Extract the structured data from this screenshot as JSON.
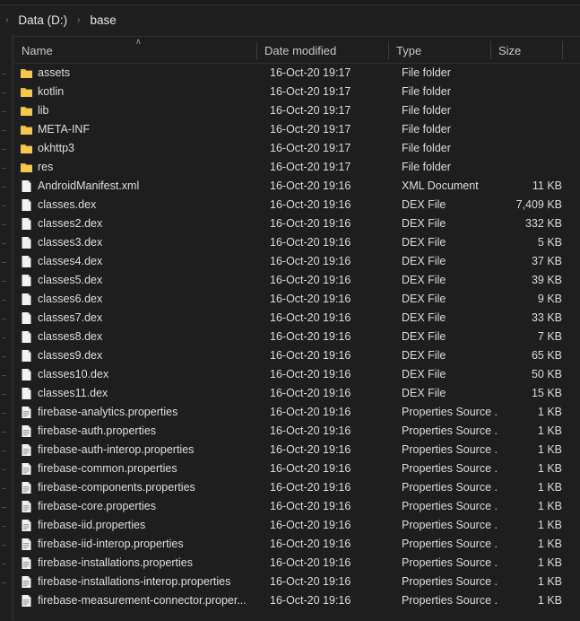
{
  "window": {
    "background_color": "#1e1e1e"
  },
  "breadcrumb": {
    "separator": "›",
    "items": [
      {
        "label": "Data (D:)"
      },
      {
        "label": "base"
      }
    ]
  },
  "columns": {
    "sort_indicator": "∧",
    "sorted_by": "Name",
    "sort_direction": "ascending",
    "headers": [
      {
        "key": "name",
        "label": "Name"
      },
      {
        "key": "date",
        "label": "Date modified"
      },
      {
        "key": "type",
        "label": "Type"
      },
      {
        "key": "size",
        "label": "Size"
      }
    ]
  },
  "colors": {
    "folder_icon": "#f5c84c",
    "file_icon": "#f2f2f2",
    "text": "#dcdcdc"
  },
  "files": [
    {
      "name": "assets",
      "date": "16-Oct-20 19:17",
      "type": "File folder",
      "size": "",
      "icon": "folder-icon"
    },
    {
      "name": "kotlin",
      "date": "16-Oct-20 19:17",
      "type": "File folder",
      "size": "",
      "icon": "folder-icon"
    },
    {
      "name": "lib",
      "date": "16-Oct-20 19:17",
      "type": "File folder",
      "size": "",
      "icon": "folder-icon"
    },
    {
      "name": "META-INF",
      "date": "16-Oct-20 19:17",
      "type": "File folder",
      "size": "",
      "icon": "folder-icon"
    },
    {
      "name": "okhttp3",
      "date": "16-Oct-20 19:17",
      "type": "File folder",
      "size": "",
      "icon": "folder-icon"
    },
    {
      "name": "res",
      "date": "16-Oct-20 19:17",
      "type": "File folder",
      "size": "",
      "icon": "folder-icon"
    },
    {
      "name": "AndroidManifest.xml",
      "date": "16-Oct-20 19:16",
      "type": "XML Document",
      "size": "11 KB",
      "icon": "file-icon"
    },
    {
      "name": "classes.dex",
      "date": "16-Oct-20 19:16",
      "type": "DEX File",
      "size": "7,409 KB",
      "icon": "file-icon"
    },
    {
      "name": "classes2.dex",
      "date": "16-Oct-20 19:16",
      "type": "DEX File",
      "size": "332 KB",
      "icon": "file-icon"
    },
    {
      "name": "classes3.dex",
      "date": "16-Oct-20 19:16",
      "type": "DEX File",
      "size": "5 KB",
      "icon": "file-icon"
    },
    {
      "name": "classes4.dex",
      "date": "16-Oct-20 19:16",
      "type": "DEX File",
      "size": "37 KB",
      "icon": "file-icon"
    },
    {
      "name": "classes5.dex",
      "date": "16-Oct-20 19:16",
      "type": "DEX File",
      "size": "39 KB",
      "icon": "file-icon"
    },
    {
      "name": "classes6.dex",
      "date": "16-Oct-20 19:16",
      "type": "DEX File",
      "size": "9 KB",
      "icon": "file-icon"
    },
    {
      "name": "classes7.dex",
      "date": "16-Oct-20 19:16",
      "type": "DEX File",
      "size": "33 KB",
      "icon": "file-icon"
    },
    {
      "name": "classes8.dex",
      "date": "16-Oct-20 19:16",
      "type": "DEX File",
      "size": "7 KB",
      "icon": "file-icon"
    },
    {
      "name": "classes9.dex",
      "date": "16-Oct-20 19:16",
      "type": "DEX File",
      "size": "65 KB",
      "icon": "file-icon"
    },
    {
      "name": "classes10.dex",
      "date": "16-Oct-20 19:16",
      "type": "DEX File",
      "size": "50 KB",
      "icon": "file-icon"
    },
    {
      "name": "classes11.dex",
      "date": "16-Oct-20 19:16",
      "type": "DEX File",
      "size": "15 KB",
      "icon": "file-icon"
    },
    {
      "name": "firebase-analytics.properties",
      "date": "16-Oct-20 19:16",
      "type": "Properties Source ...",
      "size": "1 KB",
      "icon": "properties-file-icon"
    },
    {
      "name": "firebase-auth.properties",
      "date": "16-Oct-20 19:16",
      "type": "Properties Source ...",
      "size": "1 KB",
      "icon": "properties-file-icon"
    },
    {
      "name": "firebase-auth-interop.properties",
      "date": "16-Oct-20 19:16",
      "type": "Properties Source ...",
      "size": "1 KB",
      "icon": "properties-file-icon"
    },
    {
      "name": "firebase-common.properties",
      "date": "16-Oct-20 19:16",
      "type": "Properties Source ...",
      "size": "1 KB",
      "icon": "properties-file-icon"
    },
    {
      "name": "firebase-components.properties",
      "date": "16-Oct-20 19:16",
      "type": "Properties Source ...",
      "size": "1 KB",
      "icon": "properties-file-icon"
    },
    {
      "name": "firebase-core.properties",
      "date": "16-Oct-20 19:16",
      "type": "Properties Source ...",
      "size": "1 KB",
      "icon": "properties-file-icon"
    },
    {
      "name": "firebase-iid.properties",
      "date": "16-Oct-20 19:16",
      "type": "Properties Source ...",
      "size": "1 KB",
      "icon": "properties-file-icon"
    },
    {
      "name": "firebase-iid-interop.properties",
      "date": "16-Oct-20 19:16",
      "type": "Properties Source ...",
      "size": "1 KB",
      "icon": "properties-file-icon"
    },
    {
      "name": "firebase-installations.properties",
      "date": "16-Oct-20 19:16",
      "type": "Properties Source ...",
      "size": "1 KB",
      "icon": "properties-file-icon"
    },
    {
      "name": "firebase-installations-interop.properties",
      "date": "16-Oct-20 19:16",
      "type": "Properties Source ...",
      "size": "1 KB",
      "icon": "properties-file-icon"
    },
    {
      "name": "firebase-measurement-connector.proper...",
      "date": "16-Oct-20 19:16",
      "type": "Properties Source ...",
      "size": "1 KB",
      "icon": "properties-file-icon"
    }
  ]
}
